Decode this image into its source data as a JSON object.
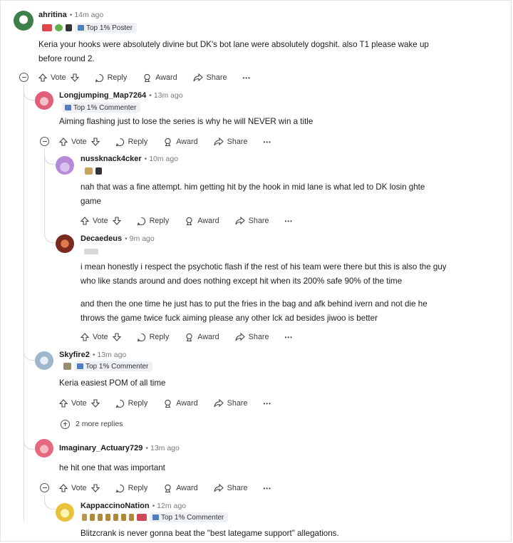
{
  "actions": {
    "vote": "Vote",
    "reply": "Reply",
    "award": "Award",
    "share": "Share",
    "more": "•••"
  },
  "comments": [
    {
      "user": "ahritina",
      "meta": "• 14m ago",
      "flair": "Top 1% Poster",
      "avatar_color": "#3f7f4a",
      "lines": [
        "Keria your hooks were absolutely divine but DK's bot lane were absolutely dogshit. also T1 please wake up",
        "before round 2."
      ]
    },
    {
      "user": "Longjumping_Map7264",
      "meta": "• 13m ago",
      "flair": "Top 1% Commenter",
      "avatar_color": "#e0607a",
      "lines": [
        "Aiming flashing just to lose the series is why he will NEVER win a title"
      ]
    },
    {
      "user": "nussknack4cker",
      "meta": "• 10m ago",
      "avatar_color": "#b689d9",
      "lines": [
        "nah that was a fine attempt. him getting hit by the hook in mid lane is what led to DK losin ghte",
        "game"
      ]
    },
    {
      "user": "Decaedeus",
      "meta": "• 9m ago",
      "avatar_color": "#b5412f",
      "lines": [
        "i mean honestly i respect the psychotic flash if the rest of his team were there but this is also the guy",
        "who like stands around and does nothing except hit when its 200% safe 90% of the time",
        "and then the one time he just has to put the fries in the bag and afk behind ivern and not die he",
        "throws the game twice fuck aiming please any other lck ad besides jiwoo is better"
      ]
    },
    {
      "user": "Skyfire2",
      "meta": "• 13m ago",
      "flair": "Top 1% Commenter",
      "avatar_color": "#9fb6cc",
      "lines": [
        "Keria easiest POM of all time"
      ]
    },
    {
      "user": "Imaginary_Actuary729",
      "meta": "• 13m ago",
      "avatar_color": "#e56a80",
      "lines": [
        "he hit one that was important"
      ]
    },
    {
      "user": "KappaccinoNation",
      "meta": "• 12m ago",
      "flair": "Top 1% Commenter",
      "avatar_color": "#e8c23a",
      "lines": [
        "Blitzcrank is never gonna beat the \"best lategame support\" allegations."
      ]
    }
  ],
  "more_replies": "2 more replies"
}
